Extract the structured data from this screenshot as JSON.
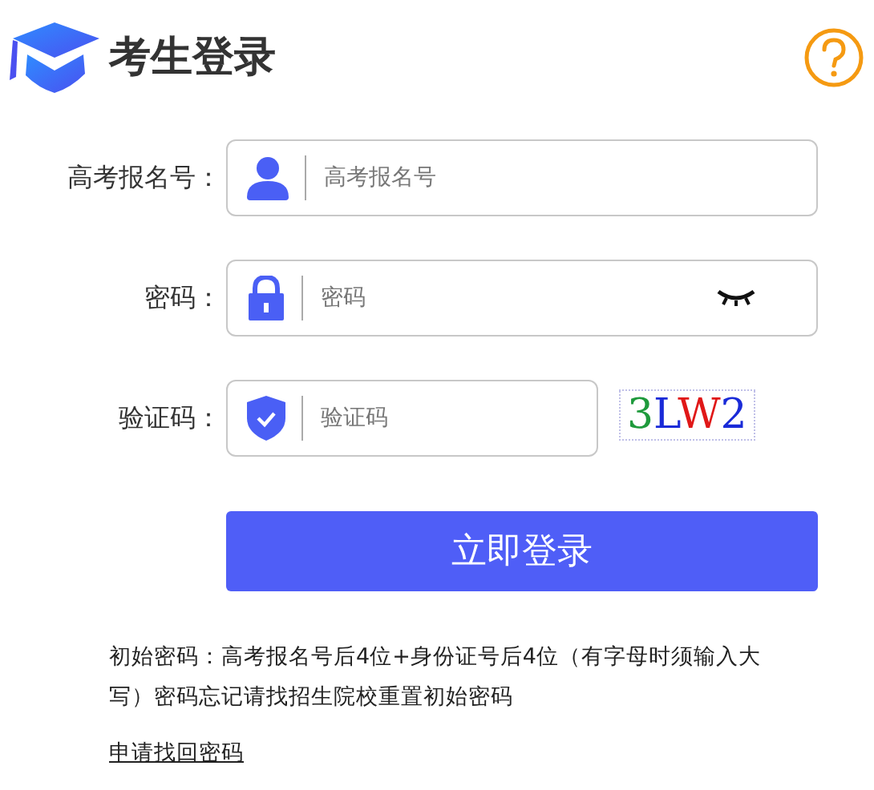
{
  "header": {
    "title": "考生登录"
  },
  "fields": [
    {
      "kind": "user",
      "label": "高考报名号：",
      "placeholder": "高考报名号"
    },
    {
      "kind": "password",
      "label": "密码：",
      "placeholder": "密码"
    },
    {
      "kind": "captcha",
      "label": "验证码：",
      "placeholder": "验证码"
    }
  ],
  "captcha": [
    {
      "char": "3",
      "color": "#1f9a3c"
    },
    {
      "char": "L",
      "color": "#1a2bd8"
    },
    {
      "char": "W",
      "color": "#e01818"
    },
    {
      "char": "2",
      "color": "#1a2bd8"
    }
  ],
  "login_button": "立即登录",
  "note": "初始密码：高考报名号后4位+身份证号后4位（有字母时须输入大写）密码忘记请找招生院校重置初始密码",
  "recover_link": "申请找回密码"
}
